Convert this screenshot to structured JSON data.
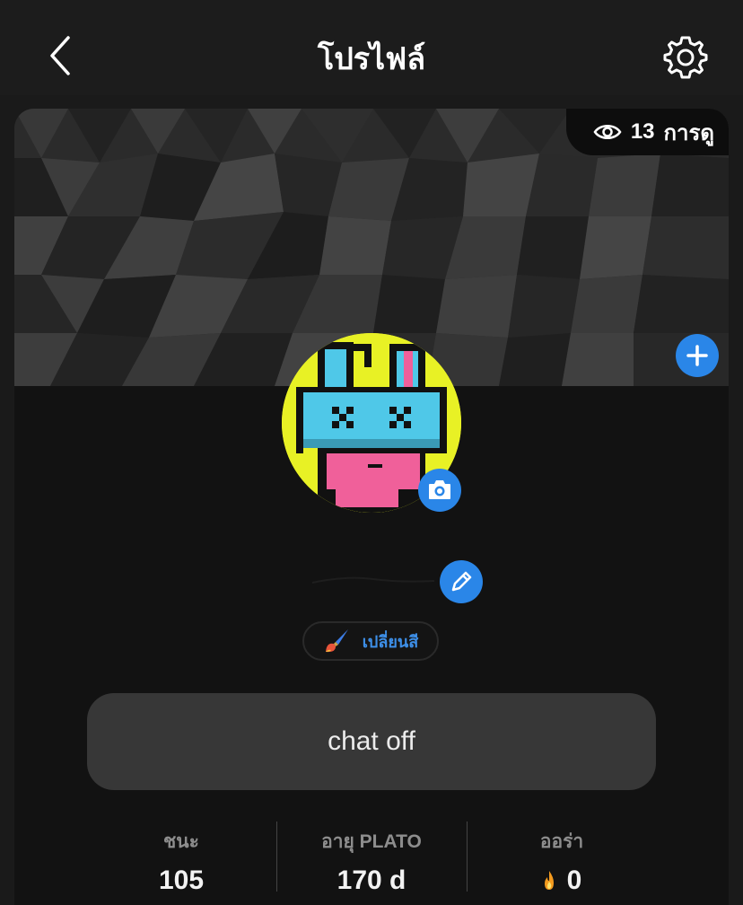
{
  "header": {
    "title": "โปรไฟล์",
    "back_icon": "chevron-left-icon",
    "settings_icon": "gear-icon"
  },
  "cover": {
    "views_count": "13",
    "views_label": "การดู",
    "views_icon": "eye-icon",
    "add_icon": "plus-icon"
  },
  "avatar": {
    "camera_icon": "camera-icon"
  },
  "name": {
    "edit_icon": "pencil-icon"
  },
  "color_button": {
    "label": "เปลี่ยนสี",
    "icon": "paintbrush-icon"
  },
  "status": {
    "text": "chat off"
  },
  "stats": [
    {
      "label": "ชนะ",
      "value": "105"
    },
    {
      "label": "อายุ PLATO",
      "value": "170 d"
    },
    {
      "label": "ออร่า",
      "value": "0",
      "icon": "flame-icon"
    }
  ],
  "colors": {
    "accent": "#2a86e8",
    "background": "#121212",
    "status_box": "#373737"
  }
}
